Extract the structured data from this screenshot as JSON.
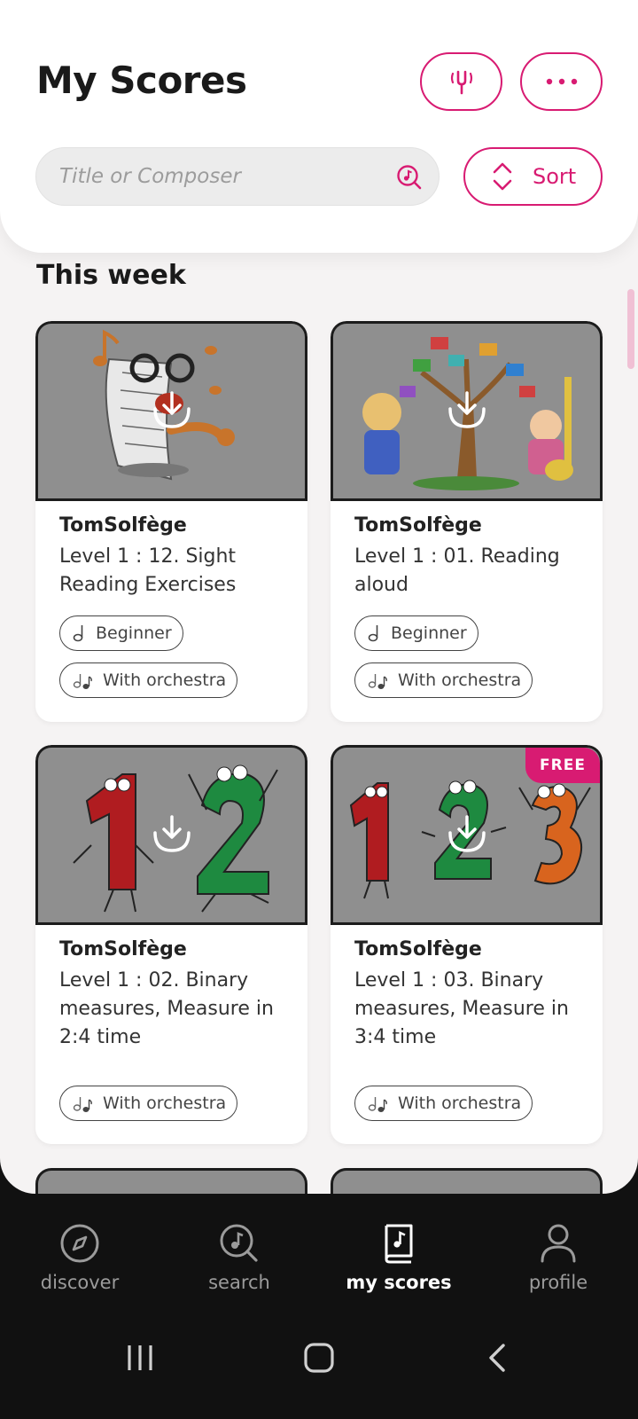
{
  "header": {
    "title": "My Scores",
    "search_placeholder": "Title or Composer",
    "sort_label": "Sort",
    "accent_color": "#d81b72"
  },
  "section": {
    "title": "This week"
  },
  "cards": [
    {
      "author": "TomSolfège",
      "title": "Level 1 : 12. Sight Reading Exercises",
      "tags": [
        "Beginner",
        "With orchestra"
      ],
      "free": false
    },
    {
      "author": "TomSolfège",
      "title": "Level 1 : 01. Reading aloud",
      "tags": [
        "Beginner",
        "With orchestra"
      ],
      "free": false
    },
    {
      "author": "TomSolfège",
      "title": "Level 1 : 02. Binary measures, Measure in 2:4 time",
      "tags": [
        "With orchestra"
      ],
      "free": false
    },
    {
      "author": "TomSolfège",
      "title": "Level 1 : 03. Binary measures, Measure in 3:4 time",
      "tags": [
        "With orchestra"
      ],
      "free": true,
      "badge": "FREE"
    }
  ],
  "nav": {
    "items": [
      {
        "label": "discover",
        "icon": "compass-icon"
      },
      {
        "label": "search",
        "icon": "search-music-icon"
      },
      {
        "label": "my scores",
        "icon": "score-book-icon",
        "active": true
      },
      {
        "label": "profile",
        "icon": "person-icon"
      }
    ]
  },
  "system_nav": [
    "recent-apps-icon",
    "home-icon",
    "back-icon"
  ]
}
